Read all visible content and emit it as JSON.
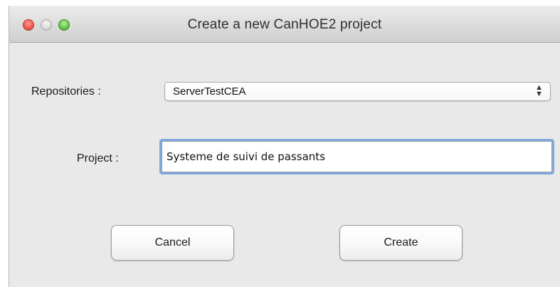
{
  "window": {
    "title": "Create a new CanHOE2 project"
  },
  "form": {
    "repositories_label": "Repositories :",
    "repositories_value": "ServerTestCEA",
    "project_label": "Project :",
    "project_value": "Systeme de suivi de passants"
  },
  "buttons": {
    "cancel_label": "Cancel",
    "create_label": "Create"
  },
  "icons": {
    "close": "close-icon",
    "minimize": "minimize-icon",
    "zoom": "zoom-icon",
    "select_arrows": "updown-arrows-icon"
  },
  "colors": {
    "close": "#f45c51",
    "zoom": "#68c94a",
    "focus_ring": "#7fa9de",
    "window_bg": "#e9e9e9"
  }
}
